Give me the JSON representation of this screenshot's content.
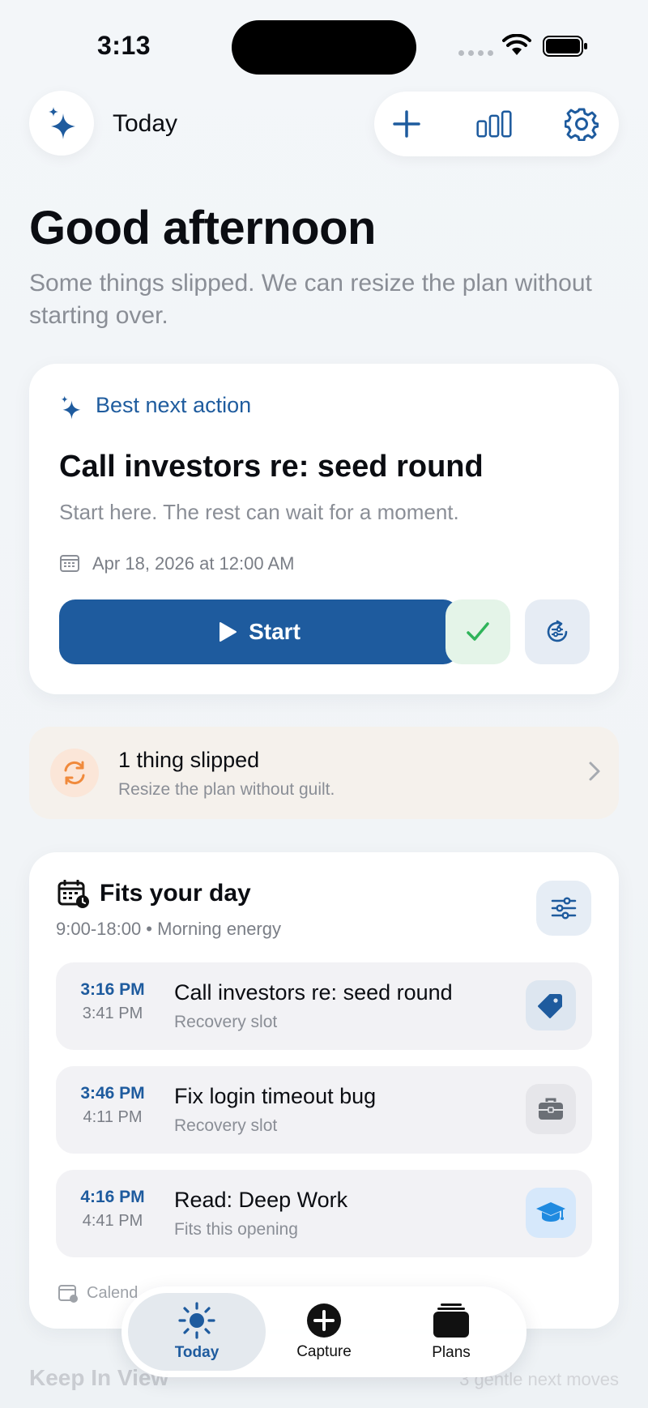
{
  "status_bar": {
    "time": "3:13"
  },
  "header": {
    "title": "Today",
    "brand_icon": "sparkle-icon"
  },
  "greeting": {
    "title": "Good afternoon",
    "subtitle": "Some things slipped. We can resize the plan without starting over."
  },
  "best_next": {
    "label": "Best next action",
    "title": "Call investors re: seed round",
    "subtitle": "Start here. The rest can wait for a moment.",
    "date": "Apr 18, 2026 at 12:00 AM",
    "start_label": "Start"
  },
  "slipped": {
    "title": "1 thing slipped",
    "subtitle": "Resize the plan without guilt."
  },
  "fits": {
    "title": "Fits your day",
    "subtitle": "9:00-18:00 • Morning energy",
    "slots": [
      {
        "start": "3:16 PM",
        "end": "3:41 PM",
        "title": "Call investors re: seed round",
        "subtitle": "Recovery slot",
        "icon": "tag-icon",
        "badge_color": "#dde6f0"
      },
      {
        "start": "3:46 PM",
        "end": "4:11 PM",
        "title": "Fix login timeout bug",
        "subtitle": "Recovery slot",
        "icon": "briefcase-icon",
        "badge_color": "#e6e6ea"
      },
      {
        "start": "4:16 PM",
        "end": "4:41 PM",
        "title": "Read: Deep Work",
        "subtitle": "Fits this opening",
        "icon": "graduation-cap-icon",
        "badge_color": "#d6e8fb"
      }
    ],
    "footer": "Calend"
  },
  "keep_in_view": {
    "title": "Keep In View",
    "subtitle": "3 gentle next moves"
  },
  "tabs": [
    {
      "label": "Today",
      "icon": "sun-icon",
      "active": true
    },
    {
      "label": "Capture",
      "icon": "plus-circle-icon",
      "active": false
    },
    {
      "label": "Plans",
      "icon": "stack-icon",
      "active": false
    }
  ],
  "colors": {
    "accent": "#1e5b9e",
    "success": "#2fb45a",
    "warning": "#f08a3c"
  }
}
